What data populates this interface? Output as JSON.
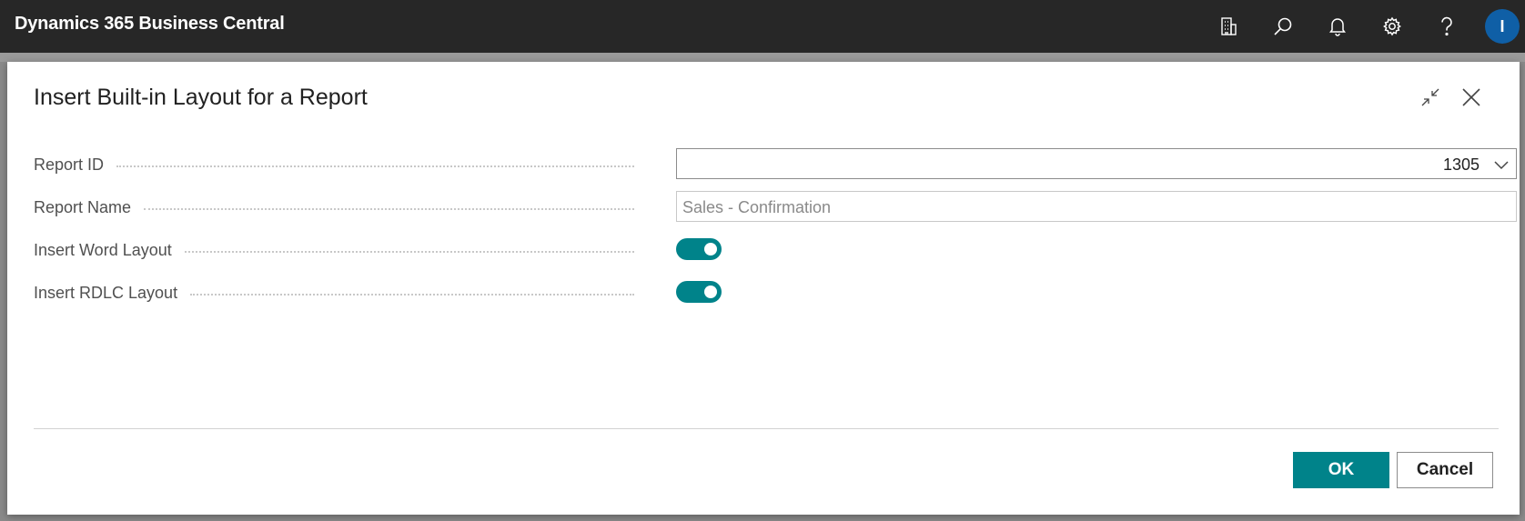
{
  "topbar": {
    "app_title": "Dynamics 365 Business Central",
    "icons": [
      "building-icon",
      "search-icon",
      "bell-icon",
      "gear-icon",
      "help-icon"
    ],
    "avatar_initial": "I",
    "avatar_color": "#0f5fa6"
  },
  "dialog": {
    "title": "Insert Built-in Layout for a Report",
    "fields": {
      "report_id": {
        "label": "Report ID",
        "value": "1305"
      },
      "report_name": {
        "label": "Report Name",
        "value": "Sales - Confirmation"
      },
      "insert_word": {
        "label": "Insert Word Layout",
        "enabled": true
      },
      "insert_rdlc": {
        "label": "Insert RDLC Layout",
        "enabled": true
      }
    },
    "buttons": {
      "ok": "OK",
      "cancel": "Cancel"
    }
  },
  "colors": {
    "accent": "#00838a",
    "topbar_bg": "#272727"
  }
}
